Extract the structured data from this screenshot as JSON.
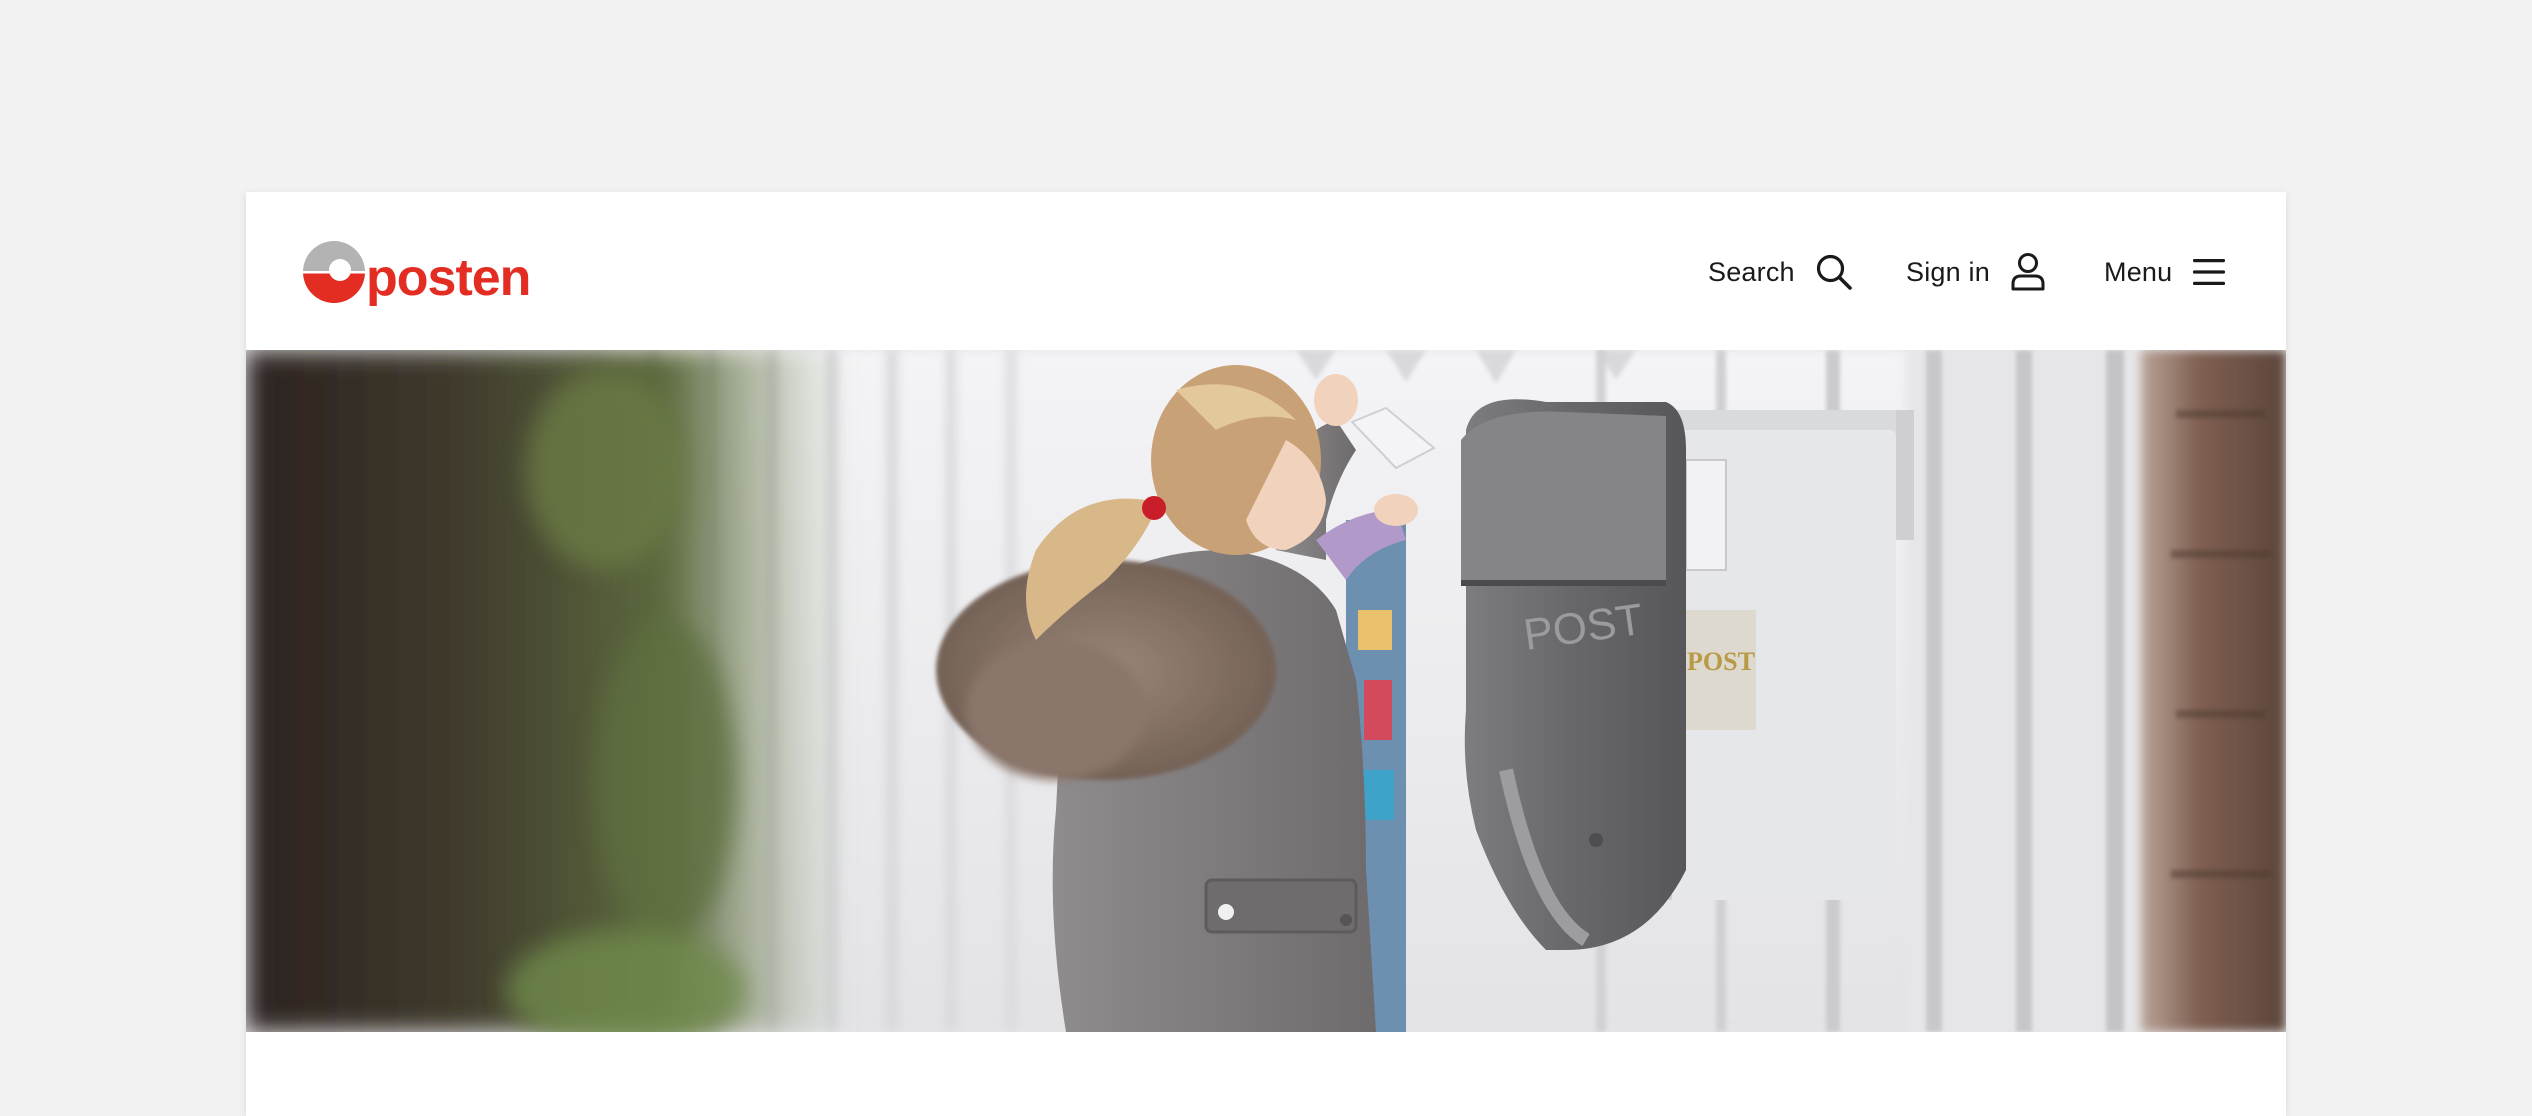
{
  "header": {
    "logo_text": "posten",
    "nav": {
      "search_label": "Search",
      "signin_label": "Sign in",
      "menu_label": "Menu"
    }
  },
  "icons": {
    "logo": "posten-logo-icon",
    "search": "search-icon",
    "signin": "user-icon",
    "menu": "hamburger-menu-icon"
  },
  "colors": {
    "brand_red": "#e32d22",
    "logo_grey": "#b3b3b3",
    "page_background": "#f2f2f2",
    "text": "#1a1a1a"
  },
  "hero": {
    "mailbox_dark_text": "POST",
    "mailbox_light_text": "POST"
  }
}
